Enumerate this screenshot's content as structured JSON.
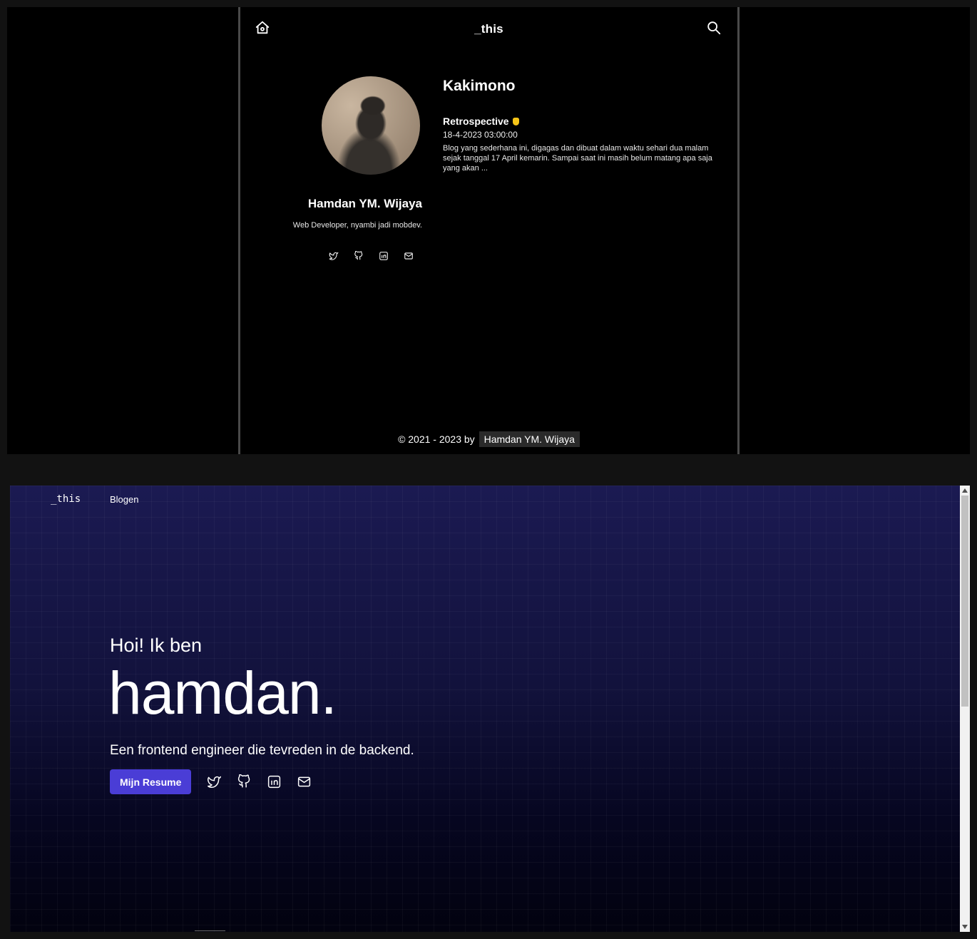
{
  "top": {
    "brand": "_this",
    "blog_title": "Kakimono",
    "post": {
      "title": "Retrospective",
      "date": "18-4-2023 03:00:00",
      "excerpt": "Blog yang sederhana ini, digagas dan dibuat dalam waktu sehari dua malam sejak tanggal 17 April kemarin. Sampai saat ini masih belum matang apa saja yang akan ..."
    },
    "author": {
      "name": "Hamdan YM. Wijaya",
      "role": "Web Developer, nyambi jadi mobdev.",
      "socials": [
        "twitter-icon",
        "github-icon",
        "linkedin-icon",
        "mail-icon"
      ]
    },
    "footer": {
      "text": "© 2021 - 2023 by",
      "author": "Hamdan YM. Wijaya"
    }
  },
  "bottom": {
    "nav": {
      "brand": "_this",
      "blog_link": "Blogen"
    },
    "hero": {
      "greeting": "Hoi! Ik ben",
      "name": "hamdan.",
      "tagline": "Een frontend engineer die tevreden in de backend.",
      "resume_button": "Mijn Resume"
    },
    "socials": [
      "twitter-icon",
      "github-icon",
      "linkedin-icon",
      "mail-icon"
    ],
    "colors": {
      "accent": "#4a3dd6",
      "bg_top": "#1b1a52",
      "bg_bottom": "#02020f"
    }
  }
}
